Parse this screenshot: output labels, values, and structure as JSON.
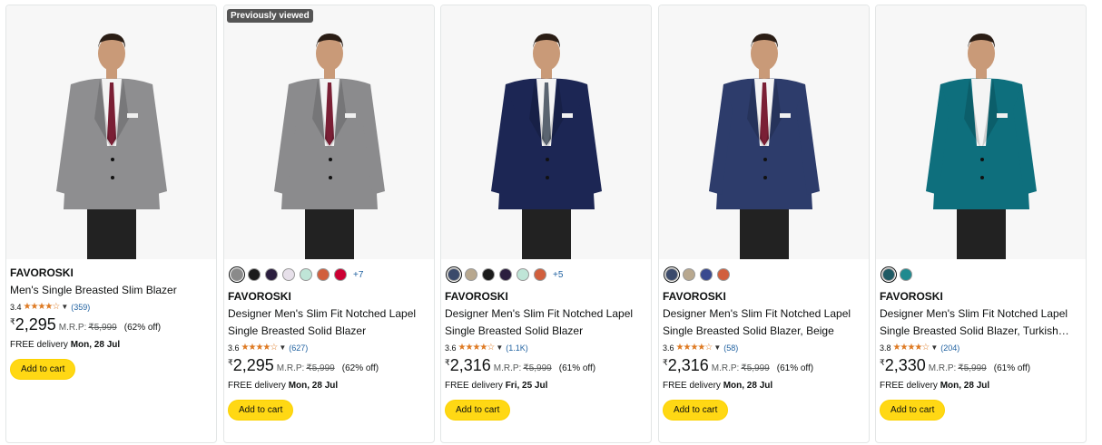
{
  "products": [
    {
      "badge": "",
      "swatches": [],
      "more_colors": "",
      "brand": "FAVOROSKI",
      "title": "Men's Single Breasted Slim Blazer",
      "rating": "3.4",
      "stars": "★★★★☆",
      "review_count": "(359)",
      "currency": "₹",
      "price": "2,295",
      "mrp_label": "M.R.P:",
      "mrp_value": "₹5,999",
      "discount": "(62% off)",
      "delivery_prefix": "FREE delivery",
      "delivery_date": "Mon, 28 Jul",
      "cta": "Add to cart",
      "suit_color": "#8e8e90",
      "tie_color": "#7a1f35"
    },
    {
      "badge": "Previously viewed",
      "swatches": [
        "#8a8a8a",
        "#1b1b1b",
        "#2b1e3f",
        "#e7e0ea",
        "#bfe5d7",
        "#d15f3d",
        "#cc0033"
      ],
      "more_colors": "+7",
      "brand": "FAVOROSKI",
      "title": "Designer Men's Slim Fit Notched Lapel Single Breasted Solid Blazer",
      "rating": "3.6",
      "stars": "★★★★☆",
      "review_count": "(627)",
      "currency": "₹",
      "price": "2,295",
      "mrp_label": "M.R.P:",
      "mrp_value": "₹5,999",
      "discount": "(62% off)",
      "delivery_prefix": "FREE delivery",
      "delivery_date": "Mon, 28 Jul",
      "cta": "Add to cart",
      "suit_color": "#8b8b8d",
      "tie_color": "#7a1f35"
    },
    {
      "badge": "",
      "swatches": [
        "#3b4a6b",
        "#b8a88f",
        "#1b1b1b",
        "#2b1e3f",
        "#bfe5d7",
        "#d15f3d"
      ],
      "more_colors": "+5",
      "brand": "FAVOROSKI",
      "title": "Designer Men's Slim Fit Notched Lapel Single Breasted Solid Blazer",
      "rating": "3.6",
      "stars": "★★★★☆",
      "review_count": "(1.1K)",
      "currency": "₹",
      "price": "2,316",
      "mrp_label": "M.R.P:",
      "mrp_value": "₹5,999",
      "discount": "(61% off)",
      "delivery_prefix": "FREE delivery",
      "delivery_date": "Fri, 25 Jul",
      "cta": "Add to cart",
      "suit_color": "#1c2654",
      "tie_color": "#5a6470"
    },
    {
      "badge": "",
      "swatches": [
        "#3b4a6b",
        "#b8a88f",
        "#3a4a8f",
        "#d15f3d"
      ],
      "more_colors": "",
      "brand": "FAVOROSKI",
      "title": "Designer Men's Slim Fit Notched Lapel Single Breasted Solid Blazer, Beige",
      "rating": "3.6",
      "stars": "★★★★☆",
      "review_count": "(58)",
      "currency": "₹",
      "price": "2,316",
      "mrp_label": "M.R.P:",
      "mrp_value": "₹5,999",
      "discount": "(61% off)",
      "delivery_prefix": "FREE delivery",
      "delivery_date": "Mon, 28 Jul",
      "cta": "Add to cart",
      "suit_color": "#2d3c6b",
      "tie_color": "#7a1f35"
    },
    {
      "badge": "",
      "swatches": [
        "#1e5a64",
        "#1f8a8f"
      ],
      "more_colors": "",
      "brand": "FAVOROSKI",
      "title": "Designer Men's Slim Fit Notched Lapel Single Breasted Solid Blazer, Turkish…",
      "rating": "3.8",
      "stars": "★★★★☆",
      "review_count": "(204)",
      "currency": "₹",
      "price": "2,330",
      "mrp_label": "M.R.P:",
      "mrp_value": "₹5,999",
      "discount": "(61% off)",
      "delivery_prefix": "FREE delivery",
      "delivery_date": "Mon, 28 Jul",
      "cta": "Add to cart",
      "suit_color": "#0e6f7d",
      "tie_color": ""
    }
  ]
}
